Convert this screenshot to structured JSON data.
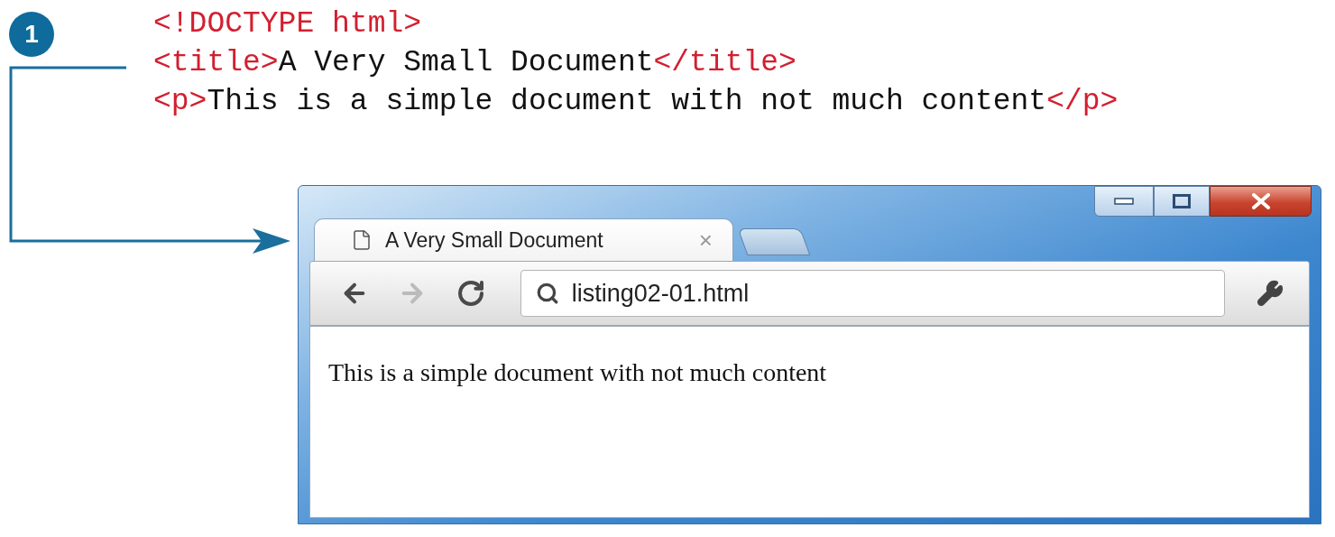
{
  "badge": "1",
  "code_lines": [
    [
      {
        "kind": "tag",
        "text": "<!DOCTYPE html>"
      }
    ],
    [
      {
        "kind": "tag",
        "text": "<title>"
      },
      {
        "kind": "text",
        "text": "A Very Small Document"
      },
      {
        "kind": "tag",
        "text": "</title>"
      }
    ],
    [
      {
        "kind": "tag",
        "text": "<p>"
      },
      {
        "kind": "text",
        "text": "This is a simple document with not much content"
      },
      {
        "kind": "tag",
        "text": "</p>"
      }
    ]
  ],
  "browser": {
    "tabs": [
      {
        "label": "A Very Small Document",
        "selected": true,
        "close": "×"
      }
    ],
    "nav": [
      {
        "kind": "back",
        "disabled": false
      },
      {
        "kind": "forward",
        "disabled": true
      },
      {
        "kind": "reload",
        "disabled": false
      }
    ],
    "address": "listing02-01.html",
    "content": "This is a simple document with not much content"
  }
}
